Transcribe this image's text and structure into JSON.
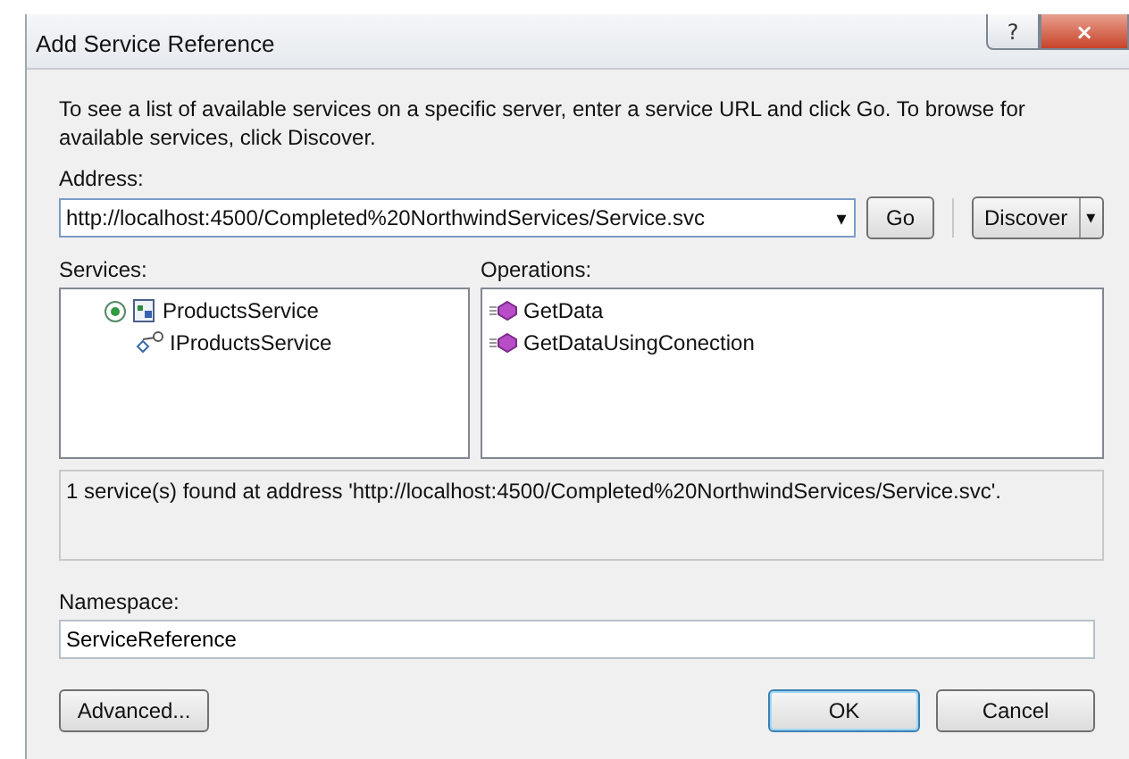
{
  "window": {
    "title": "Add Service Reference",
    "help_button": "?",
    "close_button": "×"
  },
  "intro": "To see a list of available services on a specific server, enter a service URL and click Go. To browse for available services, click Discover.",
  "address": {
    "label": "Address:",
    "value": "http://localhost:4500/Completed%20NorthwindServices/Service.svc",
    "dropdown": "▾"
  },
  "go_button": "Go",
  "discover_button": {
    "label": "Discover",
    "dropdown": "▾"
  },
  "services": {
    "label": "Services:",
    "items": [
      {
        "label": "ProductsService",
        "expanded": true,
        "children": [
          {
            "label": "IProductsService"
          }
        ]
      }
    ]
  },
  "operations": {
    "label": "Operations:",
    "items": [
      "GetData",
      "GetDataUsingConection"
    ]
  },
  "status": "1 service(s) found at address 'http://localhost:4500/Completed%20NorthwindServices/Service.svc'.",
  "namespace": {
    "label": "Namespace:",
    "value": "ServiceReference"
  },
  "buttons": {
    "advanced": "Advanced...",
    "ok": "OK",
    "cancel": "Cancel"
  }
}
